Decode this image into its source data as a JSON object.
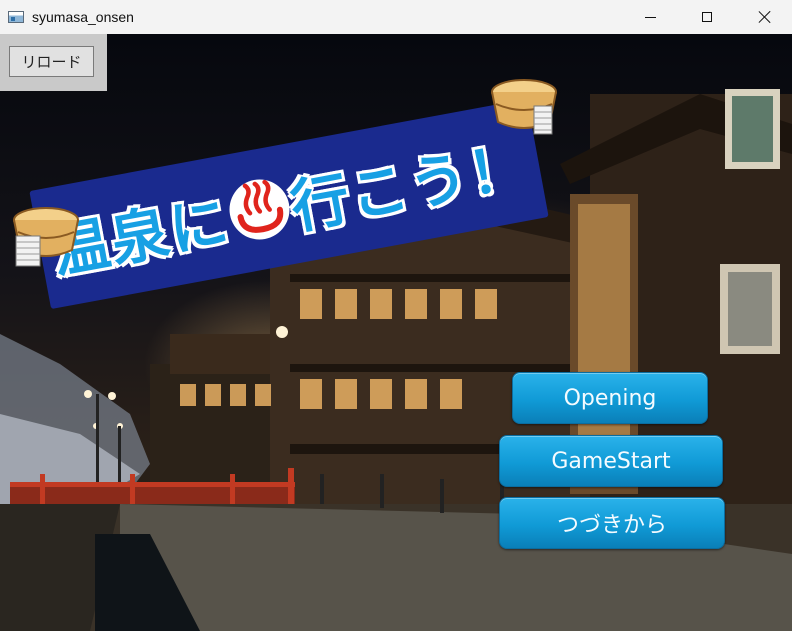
{
  "window": {
    "title": "syumasa_onsen"
  },
  "toolbar": {
    "reload_label": "リロード"
  },
  "logo": {
    "text_part1": "温泉に",
    "text_part2": "行こう！",
    "icon": "onsen-icon"
  },
  "menu": {
    "opening_label": "Opening",
    "gamestart_label": "GameStart",
    "continue_label": "つづきから"
  },
  "colors": {
    "button_blue": "#109ad6",
    "banner_navy": "#1a2a8e",
    "logo_text_blue": "#17a0e4"
  }
}
